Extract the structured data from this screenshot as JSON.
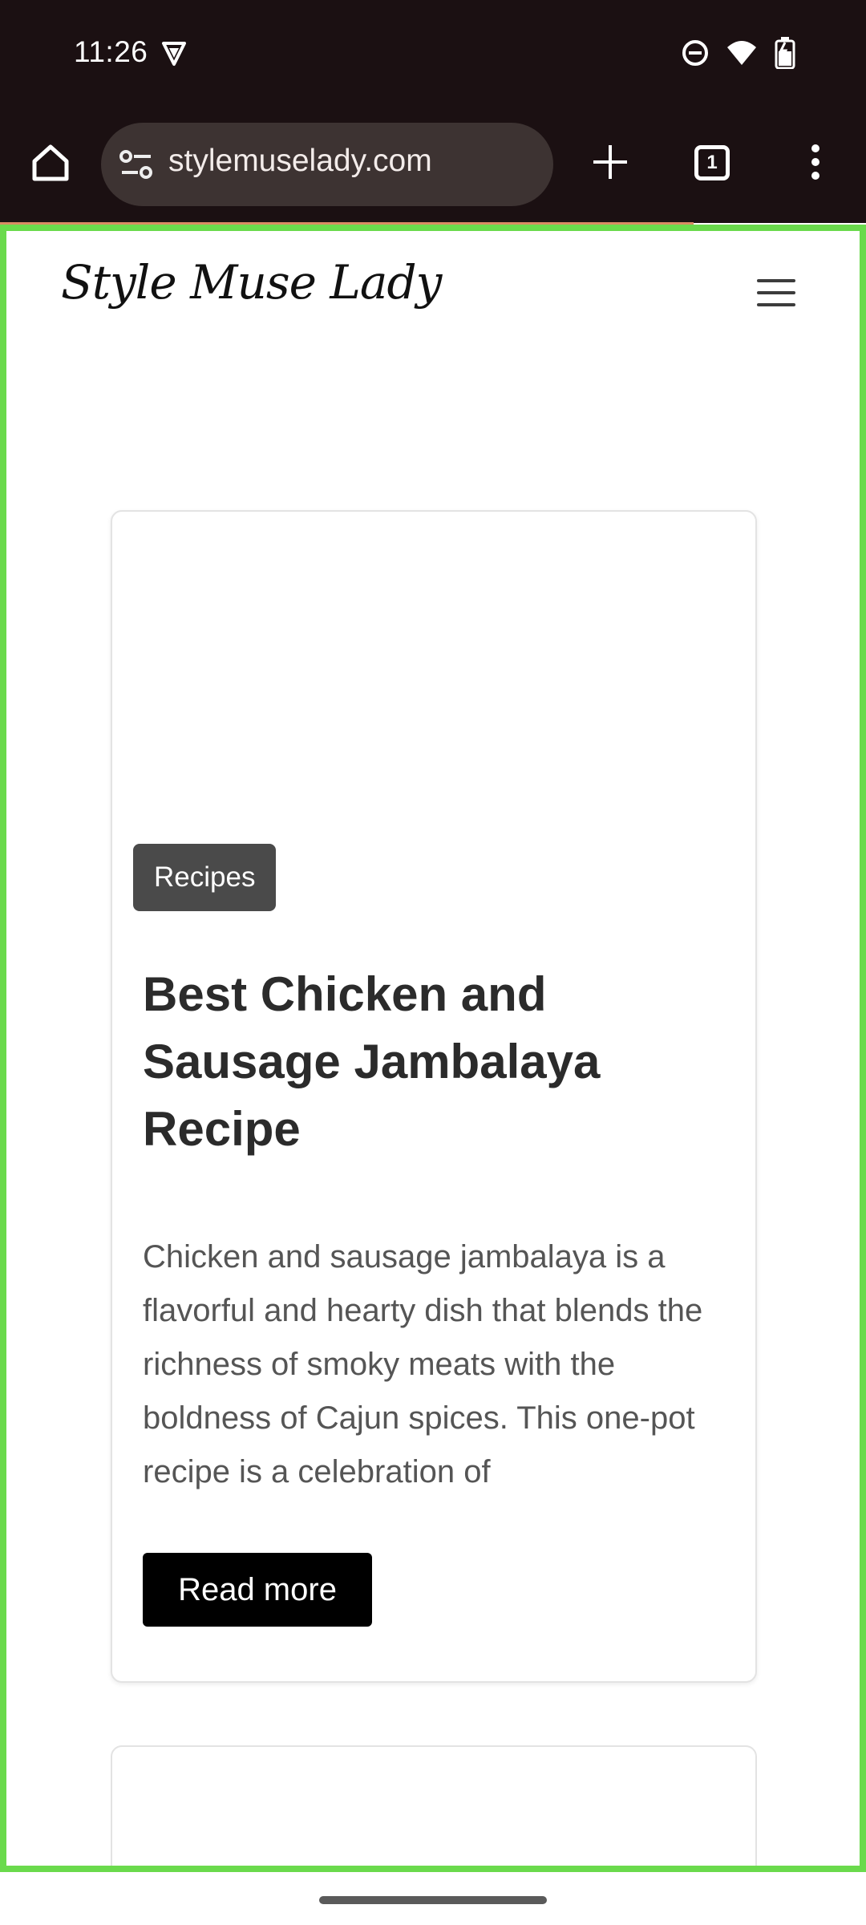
{
  "status": {
    "time": "11:26",
    "icons": [
      "vpn-shield-icon",
      "do-not-disturb-icon",
      "wifi-icon",
      "battery-icon"
    ]
  },
  "browser": {
    "url": "stylemuselady.com",
    "tab_count": "1",
    "icons": [
      "home-icon",
      "site-settings-icon",
      "new-tab-icon",
      "tab-switcher-icon",
      "overflow-menu-icon"
    ]
  },
  "site": {
    "logo": "Style Muse Lady",
    "menu_icon": "hamburger-menu-icon"
  },
  "article": {
    "category": "Recipes",
    "title": "Best Chicken and Sausage Jambalaya Recipe",
    "excerpt": "Chicken and sausage jambalaya is a flavorful and hearty dish that blends the richness of smoky meats with the boldness of Cajun spices. This one-pot recipe is a celebration of",
    "button": "Read more"
  },
  "colors": {
    "chrome_bg": "#1b1012",
    "url_bar_bg": "#3d3332",
    "frame_highlight": "#6ada4c",
    "badge_bg": "#4a4a4a",
    "button_bg": "#000000"
  }
}
